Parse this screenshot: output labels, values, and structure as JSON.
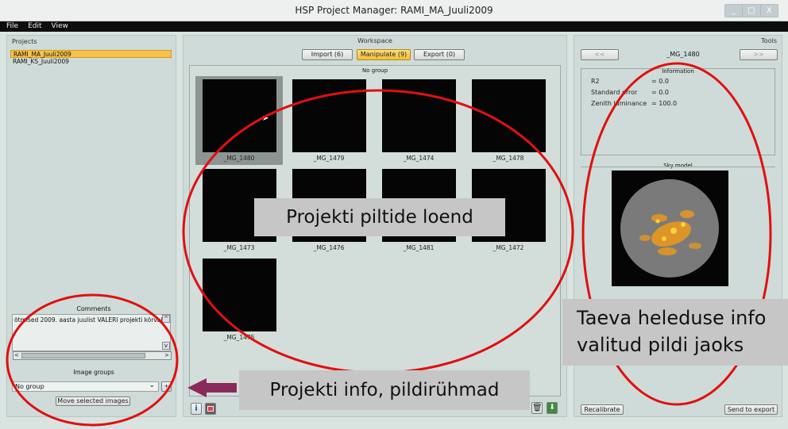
{
  "window": {
    "title": "HSP Project Manager: RAMI_MA_Juuli2009",
    "controls": [
      "_",
      "□",
      "X"
    ]
  },
  "menu": [
    "File",
    "Edit",
    "View"
  ],
  "projects": {
    "title": "Projects",
    "items": [
      "RAMI_MA_Juuli2009",
      "RAMI_KS_Juuli2009"
    ],
    "selected_index": 0
  },
  "comments": {
    "title": "Comments",
    "text": "õtmised 2009. aasta juulist VALERI projekti kõrvalt",
    "scroll_up": "^",
    "scroll_down": "v",
    "scroll_left": "<",
    "scroll_right": ">"
  },
  "image_groups": {
    "title": "Image groups",
    "selected": "No group",
    "move_button": "Move selected images"
  },
  "workspace": {
    "title": "Workspace",
    "tabs": [
      {
        "label": "Import (6)",
        "active": false
      },
      {
        "label": "Manipulate (9)",
        "active": true
      },
      {
        "label": "Export (0)",
        "active": false
      }
    ],
    "group_label": "No group",
    "images": [
      {
        "name": "_MG_1480",
        "selected": true
      },
      {
        "name": "_MG_1479",
        "selected": false
      },
      {
        "name": "_MG_1474",
        "selected": false
      },
      {
        "name": "_MG_1478",
        "selected": false
      },
      {
        "name": "_MG_1473",
        "selected": false
      },
      {
        "name": "_MG_1476",
        "selected": false
      },
      {
        "name": "_MG_1481",
        "selected": false
      },
      {
        "name": "_MG_1472",
        "selected": false
      },
      {
        "name": "_MG_1475",
        "selected": false
      }
    ]
  },
  "tools": {
    "title": "Tools",
    "prev": "<<",
    "next": ">>",
    "current_image": "_MG_1480",
    "info_title": "Information",
    "r2_label": "R2",
    "r2_value": "= 0.0",
    "stderr_label": "Standard error",
    "stderr_value": "= 0.0",
    "zenith_label": "Zenith luminance",
    "zenith_value": "= 100.0",
    "skymodel_title": "Sky model",
    "recalibrate": "Recalibrate",
    "send_to_export": "Send to export"
  },
  "annotations": {
    "images_list": "Projekti piltide loend",
    "sky_info_line1": "Taeva heleduse info",
    "sky_info_line2": "valitud pildi jaoks",
    "project_info": "Projekti info, pildirühmad"
  },
  "colors": {
    "accent": "#f6c24a",
    "annotation_red": "#e01010",
    "arrow": "#8a2a5a"
  }
}
